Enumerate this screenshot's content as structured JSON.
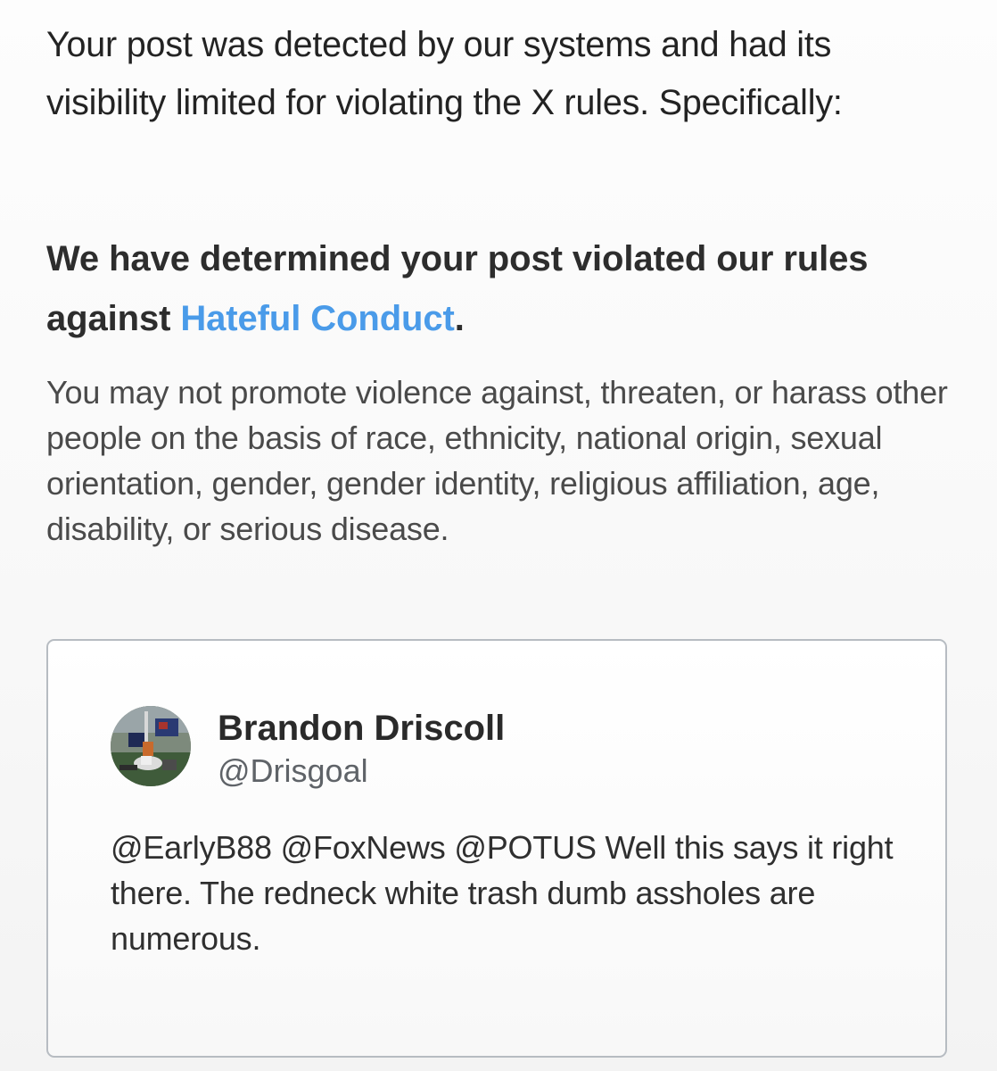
{
  "notice": {
    "intro": "Your post was detected by our systems and had its visibility limited for violating the X rules. Specifically:",
    "headline_prefix": "We have determined your post violated our rules against ",
    "headline_link": "Hateful Conduct",
    "headline_suffix": ".",
    "explanation": "You may not promote violence against, threaten, or harass other people on the basis of race, ethnicity, national origin, sexual orientation, gender, gender identity, religious affiliation, age, disability, or serious disease.",
    "link_color": "#4a9be9"
  },
  "post": {
    "display_name": "Brandon Driscoll",
    "handle": "@Drisgoal",
    "text": "@EarlyB88 @FoxNews @POTUS Well this says it right there. The redneck white trash dumb assholes are numerous.",
    "avatar_icon": "profile-photo"
  }
}
